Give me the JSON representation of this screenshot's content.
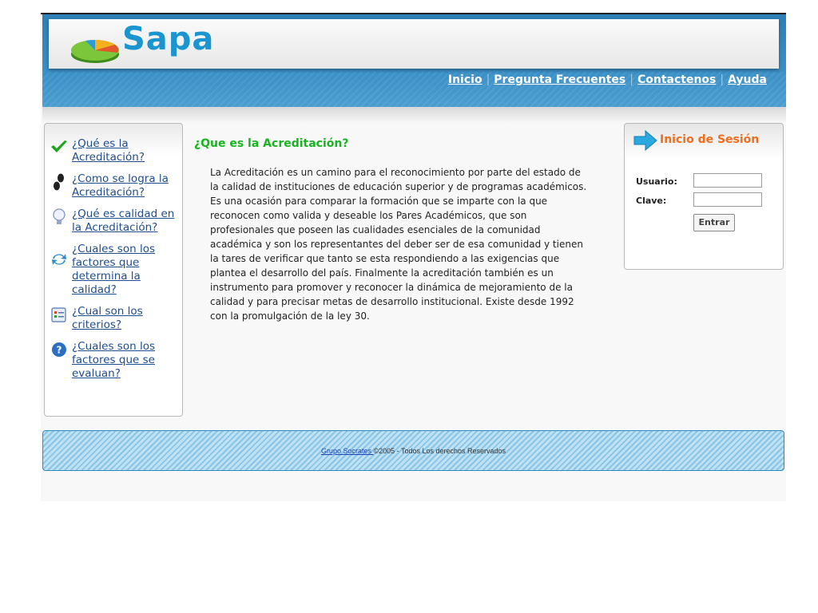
{
  "header": {
    "logo_text": "Sapa",
    "nav": [
      {
        "label": "Inicio"
      },
      {
        "label": "Pregunta Frecuentes"
      },
      {
        "label": "Contactenos"
      },
      {
        "label": "Ayuda"
      }
    ],
    "nav_separator": "|"
  },
  "sidebar": {
    "items": [
      {
        "label": "¿Qué es la Acreditación?",
        "icon": "checkmark-icon"
      },
      {
        "label": "¿Como se logra la Acreditación?",
        "icon": "footprints-icon"
      },
      {
        "label": "¿Qué es calidad en la Acreditación?",
        "icon": "lightbulb-icon"
      },
      {
        "label": "¿Cuales son los factores que determina la calidad?",
        "icon": "refresh-arrows-icon"
      },
      {
        "label": "¿Cual son los criterios?",
        "icon": "document-list-icon"
      },
      {
        "label": "¿Cuales son los factores que se evaluan?",
        "icon": "help-question-icon"
      }
    ]
  },
  "main": {
    "title": "¿Que es la Acreditación?",
    "body": "La Acreditación es un camino para el reconocimiento por parte del estado de la calidad de instituciones de educación superior y de programas académicos. Es una ocasión para comparar la formación que se imparte con la que reconocen como valida y deseable los Pares Académicos, que son profesionales que poseen las cualidades esenciales de la comunidad académica y son los representantes del deber ser de esa comunidad y tienen la tares de verificar que tanto se esta respondiendo a las exigencias que plantea el desarrollo del país. Finalmente la acreditación también es un instrumento para promover y reconocer la dinámica de mejoramiento de la calidad y para precisar metas de desarrollo institucional. Existe desde 1992 con la promulgación de la ley 30."
  },
  "login": {
    "title": "Inicio de Sesión",
    "username_label": "Usuario:",
    "password_label": "Clave:",
    "username_value": "",
    "password_value": "",
    "submit_label": "Entrar",
    "icon": "arrow-right-icon"
  },
  "footer": {
    "link_text": "Grupo Socrates ",
    "text": "©2005 - Todos Los derechos Reservados"
  },
  "colors": {
    "header_blue": "#2d7fb6",
    "logo_blue": "#1a95d0",
    "title_green": "#16b51f",
    "login_title_orange": "#ef6e1d",
    "link_blue": "#1f4d8f"
  }
}
